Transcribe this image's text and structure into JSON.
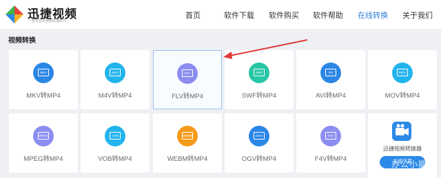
{
  "brand": {
    "title": "迅捷视频",
    "subtitle": "一款专业的视频处理软件"
  },
  "nav": {
    "items": [
      {
        "label": "首页"
      },
      {
        "label": "软件下载"
      },
      {
        "label": "软件购买"
      },
      {
        "label": "软件帮助"
      },
      {
        "label": "在线转换",
        "active": true
      },
      {
        "label": "关于我们"
      }
    ]
  },
  "section": {
    "title": "视频转换"
  },
  "tiles": [
    {
      "badge": "MKV",
      "label": "MKV转MP4",
      "icon_color": "#2b86e6",
      "icon": "video-file-icon"
    },
    {
      "badge": "M4V",
      "label": "M4V转MP4",
      "icon_color": "#22b4ec",
      "icon": "video-file-icon"
    },
    {
      "badge": "FLV",
      "label": "FLV转MP4",
      "icon_color": "#8c8df0",
      "icon": "video-file-icon",
      "selected": true
    },
    {
      "badge": "SWF",
      "label": "SWF转MP4",
      "icon_color": "#27c6a4",
      "icon": "video-file-icon"
    },
    {
      "badge": "AVI",
      "label": "AVI转MP4",
      "icon_color": "#2b86e6",
      "icon": "video-file-icon"
    },
    {
      "badge": "MOV",
      "label": "MOV转MP4",
      "icon_color": "#22b4ec",
      "icon": "video-file-icon"
    },
    {
      "badge": "MPEG",
      "label": "MPEG转MP4",
      "icon_color": "#8c8df0",
      "icon": "video-file-icon"
    },
    {
      "badge": "VOB",
      "label": "VOB转MP4",
      "icon_color": "#22b4ec",
      "icon": "video-file-icon"
    },
    {
      "badge": "WEBM",
      "label": "WEBM转MP4",
      "icon_color": "#f59a1b",
      "icon": "video-file-icon"
    },
    {
      "badge": "OGV",
      "label": "OGV转MP4",
      "icon_color": "#2b86e6",
      "icon": "video-file-icon"
    },
    {
      "badge": "F4V",
      "label": "F4V转MP4",
      "icon_color": "#8c8df0",
      "icon": "video-file-icon"
    }
  ],
  "ad": {
    "title": "迅捷视频转换器",
    "button": "立即下载",
    "icon": "video-camera-icon"
  },
  "watermark": {
    "text": "办公小能"
  },
  "annotation": {
    "color": "#e03a3a",
    "icon": "red-arrow"
  }
}
